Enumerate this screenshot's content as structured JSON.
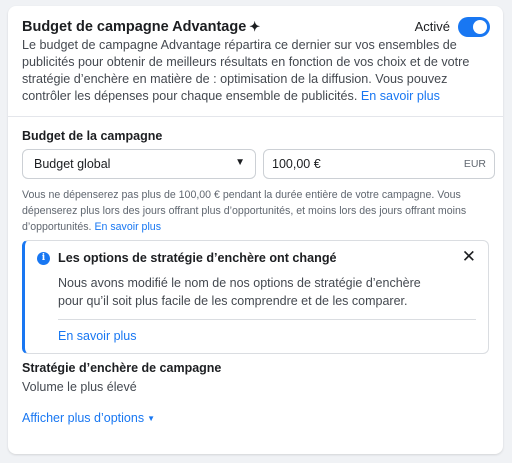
{
  "header": {
    "title": "Budget de campagne Advantage",
    "sparkle": "✦",
    "status_label": "Activé"
  },
  "description": {
    "text": "Le budget de campagne Advantage répartira ce dernier sur vos ensembles de publicités pour obtenir de meilleurs résultats en fonction de vos choix et de votre stratégie d’enchère en matière de : optimisation de la diffusion. Vous pouvez contrôler les dépenses pour chaque ensemble de publicités.",
    "link": "En savoir plus"
  },
  "budget": {
    "label": "Budget de la campagne",
    "type_value": "Budget global",
    "amount_value": "100,00 €",
    "currency": "EUR",
    "help_text": "Vous ne dépenserez pas plus de 100,00 € pendant la durée entière de votre campagne. Vous dépenserez plus lors des jours offrant plus d’opportunités, et moins lors des jours offrant moins d’opportunités.",
    "help_link": "En savoir plus"
  },
  "notice": {
    "title": "Les options de stratégie d’enchère ont changé",
    "body": "Nous avons modifié le nom de nos options de stratégie d’enchère pour qu’il soit plus facile de les comprendre et de les comparer.",
    "link": "En savoir plus",
    "info_glyph": "i",
    "close_glyph": "✕"
  },
  "bid_strategy": {
    "label": "Stratégie d’enchère de campagne",
    "value": "Volume le plus élevé"
  },
  "more_options": {
    "label": "Afficher plus d’options",
    "caret": "▼"
  },
  "colors": {
    "accent": "#1877f2",
    "text": "#1c1e21",
    "muted": "#606770"
  }
}
